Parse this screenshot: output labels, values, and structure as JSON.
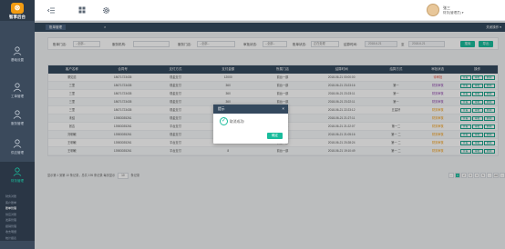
{
  "brand": {
    "logo_glyph": "⊛",
    "name": "智享后台"
  },
  "topbar": {
    "menu_icon": "menu-fold-icon",
    "grid_icon": "grid-icon",
    "settings_icon": "gear-icon",
    "user_name": "张三",
    "user_role": "财务(管理员) ▾"
  },
  "sidebar": {
    "items": [
      {
        "label": "基础设置",
        "icon": "user-icon"
      },
      {
        "label": "工单管理",
        "icon": "user-icon"
      },
      {
        "label": "服务管理",
        "icon": "user-icon"
      },
      {
        "label": "供应管理",
        "icon": "user-icon"
      },
      {
        "label": "财务管理",
        "icon": "user-icon",
        "active": true
      }
    ],
    "subitems": [
      "财务对账",
      "客户账单",
      "账单管理",
      "供应对账",
      "发票管理",
      "报销管理",
      "收支明细",
      "统计报表"
    ]
  },
  "tabs": {
    "active": "账单管理",
    "ops_label": "关闭操作 ▾"
  },
  "filters": {
    "type_label": "账单门店:",
    "type_value": "--全部--",
    "order_label": "服务机构:",
    "store_label": "服务门店:",
    "store_value": "--全部--",
    "status_label": "审批状态:",
    "status_value": "--全部--",
    "date_label": "账单状态:",
    "date_value": "正在处理",
    "time_label": "结算时间:",
    "date_from": "2018-6-21",
    "date_to": "2018-6-21",
    "search_btn": "搜索",
    "export_btn": "导出"
  },
  "table": {
    "headers": [
      "客户名称",
      "合同号",
      "支付方式",
      "支付金额",
      "所属门店",
      "结算时间",
      "结算方式",
      "审批状态",
      "操作"
    ],
    "rows": [
      [
        "董如意",
        "18671723435",
        "现金支付",
        "12000",
        "前台一部",
        "2018-06-21 00:00:00",
        "",
        "待审批",
        ""
      ],
      [
        "三里",
        "18671723435",
        "现金支付",
        "360",
        "前台一部",
        "2018-06-21 23:23:16",
        "第一",
        "财务审核",
        ""
      ],
      [
        "三里",
        "18671723435",
        "现金支付",
        "360",
        "前台一部",
        "2018-06-21 23:23:11",
        "第一",
        "财务审核",
        ""
      ],
      [
        "三里",
        "18671723435",
        "现金支付",
        "360",
        "前台一部",
        "2018-06-21 23:22:11",
        "第一",
        "财务审核",
        ""
      ],
      [
        "三里",
        "18671723435",
        "现金支付",
        "360",
        "前台一部",
        "2018-06-21 22:23:12",
        "五星好",
        "财务审核",
        ""
      ],
      [
        "未结",
        "13983035261",
        "现金支付",
        "",
        "前台一部",
        "2018-06-21 21:27:11",
        "",
        "财务审核",
        ""
      ],
      [
        "张吉",
        "13983035261",
        "平台支付",
        "4500",
        "前台一部",
        "2018-06-21 21:22:07",
        "第一二",
        "财务审核",
        ""
      ],
      [
        "刘明敏",
        "13983035261",
        "现金支付",
        "3720",
        "前台一部",
        "2018-06-21 21:05:16",
        "第一 二",
        "财务审核",
        ""
      ],
      [
        "王明敏",
        "13983035261",
        "平台支付",
        "465",
        "前台一部",
        "2018-06-21 20:28:24",
        "第一 二",
        "财务审核",
        ""
      ],
      [
        "王明敏",
        "13983035261",
        "平台支付",
        "8",
        "前台一部",
        "2018-06-21 19:10:49",
        "第一 二",
        "财务审核",
        ""
      ]
    ],
    "op_labels": [
      "查看",
      "审批",
      "删除"
    ]
  },
  "pager": {
    "summary": "显示第 1 到第 10 条记录，总共 195 条记录 每页显示",
    "page_size": "10",
    "suffix": "条记录",
    "pages": [
      "‹",
      "1",
      "2",
      "3",
      "4",
      "5",
      "...",
      "20",
      "›"
    ]
  },
  "dialog": {
    "title": "提示",
    "message": "取消成功!",
    "ok": "确定"
  },
  "colors": {
    "sidebar": "#3b4a5c",
    "header": "#34495e",
    "accent": "#1abc9c",
    "warn": "#f39c12",
    "danger": "#e74c3c"
  }
}
